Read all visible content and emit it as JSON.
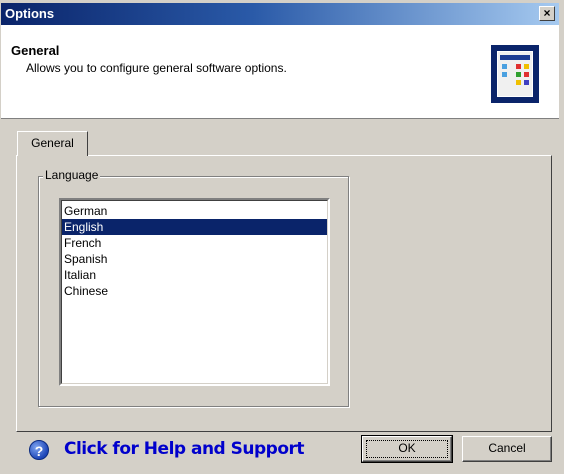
{
  "window": {
    "title": "Options",
    "close_glyph": "×"
  },
  "header": {
    "title": "General",
    "description": "Allows you to configure general software options.",
    "icon": "options-window-icon"
  },
  "tabs": [
    {
      "label": "General",
      "active": true
    }
  ],
  "language_group": {
    "label": "Language",
    "items": [
      "German",
      "English",
      "French",
      "Spanish",
      "Italian",
      "Chinese"
    ],
    "selected": "English"
  },
  "footer": {
    "help_icon_glyph": "?",
    "help_label": "Click for Help and Support",
    "ok_label": "OK",
    "cancel_label": "Cancel"
  },
  "colors": {
    "titlebar": "#0a246a",
    "selection": "#0a246a",
    "help_link": "#0000cc",
    "face": "#d4d0c8"
  }
}
